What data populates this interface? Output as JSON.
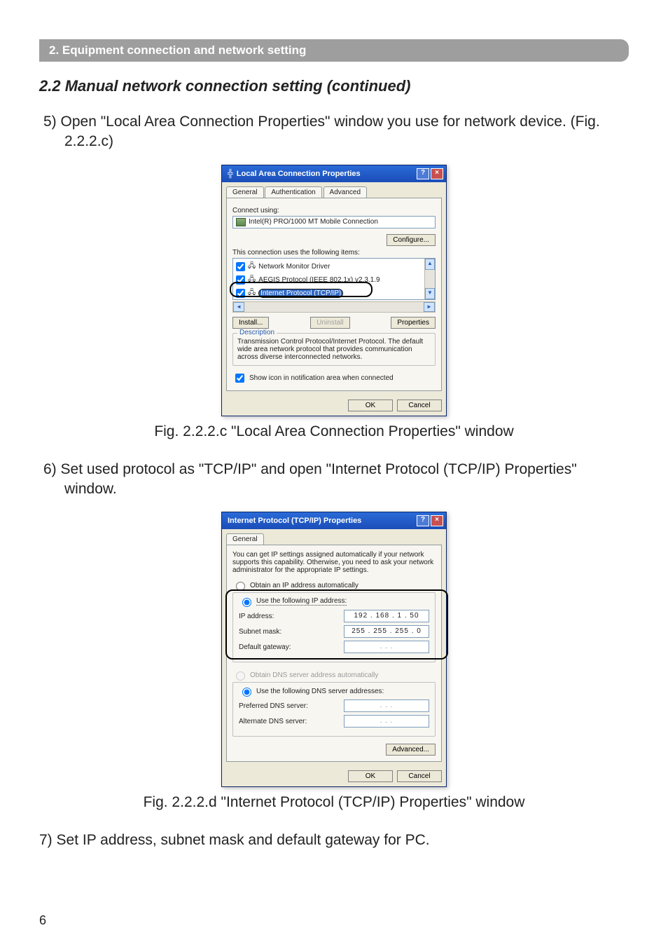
{
  "ribbon": "2. Equipment connection and network setting",
  "heading": "2.2 Manual network connection setting (continued)",
  "step5_text": "5) Open \"Local Area Connection Properties\" window you use for network device. (Fig. 2.2.2.c)",
  "figc_caption": "Fig. 2.2.2.c \"Local Area Connection Properties\" window",
  "step6_text": "6) Set used protocol as \"TCP/IP\" and open \"Internet Protocol (TCP/IP) Properties\" window.",
  "figd_caption": "Fig. 2.2.2.d \"Internet Protocol (TCP/IP) Properties\" window",
  "step7_text": "7) Set IP address, subnet mask and default gateway for PC.",
  "pagenum": "6",
  "dlg1": {
    "title": "Local Area Connection Properties",
    "tabs": [
      "General",
      "Authentication",
      "Advanced"
    ],
    "connect_using_label": "Connect using:",
    "adapter": "Intel(R) PRO/1000 MT Mobile Connection",
    "configure_btn": "Configure...",
    "items_label": "This connection uses the following items:",
    "item1": "Network Monitor Driver",
    "item2": "AEGIS Protocol (IEEE 802.1x) v2.3.1.9",
    "item3": "Internet Protocol (TCP/IP)",
    "install_btn": "Install...",
    "uninstall_btn": "Uninstall",
    "properties_btn": "Properties",
    "desc_title": "Description",
    "desc_text": "Transmission Control Protocol/Internet Protocol. The default wide area network protocol that provides communication across diverse interconnected networks.",
    "show_icon": "Show icon in notification area when connected",
    "ok": "OK",
    "cancel": "Cancel"
  },
  "dlg2": {
    "title": "Internet Protocol (TCP/IP) Properties",
    "tab": "General",
    "intro": "You can get IP settings assigned automatically if your network supports this capability. Otherwise, you need to ask your network administrator for the appropriate IP settings.",
    "opt_auto": "Obtain an IP address automatically",
    "opt_manual": "Use the following IP address:",
    "ip_label": "IP address:",
    "ip_value": "192 . 168 .   1  .  50",
    "subnet_label": "Subnet mask:",
    "subnet_value": "255 . 255 . 255 .   0",
    "gateway_label": "Default gateway:",
    "gateway_value": ".       .       .",
    "dns_auto": "Obtain DNS server address automatically",
    "dns_manual": "Use the following DNS server addresses:",
    "pref_dns_label": "Preferred DNS server:",
    "alt_dns_label": "Alternate DNS server:",
    "dns_empty": ".       .       .",
    "advanced_btn": "Advanced...",
    "ok": "OK",
    "cancel": "Cancel"
  }
}
